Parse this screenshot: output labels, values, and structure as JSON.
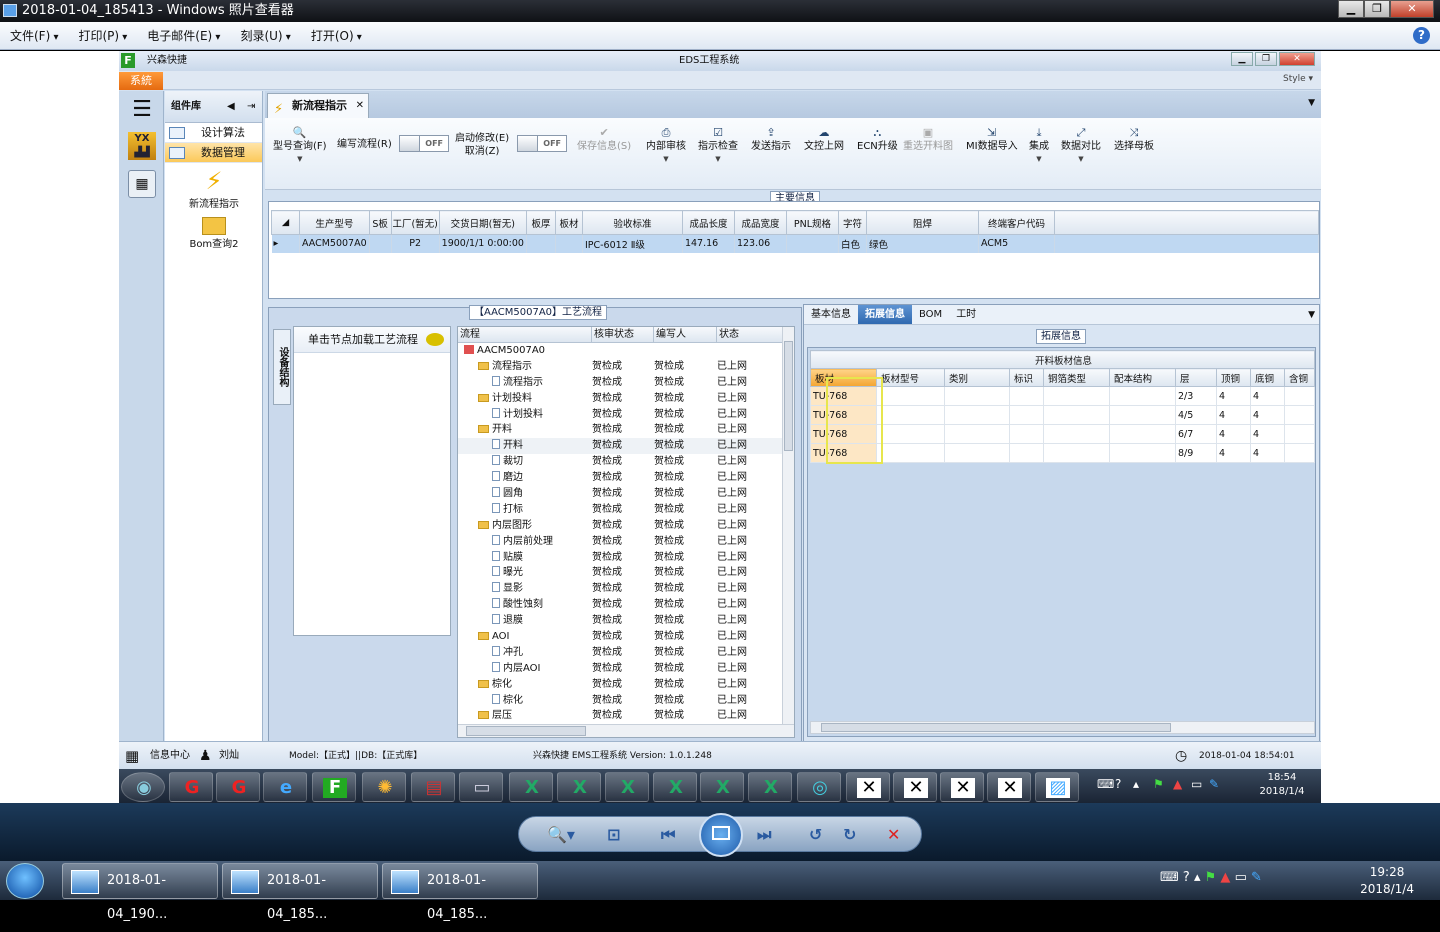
{
  "viewer": {
    "title": "2018-01-04_185413 - Windows 照片查看器",
    "menu": [
      "文件(F)",
      "打印(P)",
      "电子邮件(E)",
      "刻录(U)",
      "打开(O)"
    ],
    "help": "?"
  },
  "eds": {
    "app_short": "兴森快捷",
    "window_title": "EDS工程系统",
    "system_tab": "系統",
    "style_label": "Style ▾",
    "component_lib": "组件库",
    "lib_items": [
      "设计算法",
      "数据管理"
    ],
    "tools": [
      "新流程指示",
      "Bom查询2"
    ],
    "doc_tab": "新流程指示",
    "toolbar": {
      "model_query": "型号查询(F)",
      "write_flow": "编写流程(R)",
      "start_modify": "启动修改(E)",
      "cancel": "取消(Z)",
      "off": "OFF",
      "save_info": "保存信息(S)",
      "internal_review": "内部审核",
      "indicator_check": "指示检查",
      "publish_indicator": "发送指示",
      "upload_file": "文控上网",
      "ecn_upgrade": "ECN升级",
      "reselect_diagram": "重选开料图",
      "mi_import": "MI数据导入",
      "integrate": "集成",
      "data_compare": "数据对比",
      "select_mother": "选择母板"
    },
    "main_info": {
      "title": "主要信息",
      "headers": [
        "生产型号",
        "S板",
        "工厂(暂无)",
        "交货日期(暂无)",
        "板厚",
        "板材",
        "验收标准",
        "成品长度",
        "成品宽度",
        "PNL规格",
        "字符",
        "阻焊",
        "终端客户代码"
      ],
      "row": [
        "AACM5007A0",
        "",
        "P2",
        "1900/1/1 0:00:00",
        "",
        "",
        "IPC-6012 Ⅱ级",
        "147.16",
        "123.06",
        "",
        "白色",
        "绿色",
        "ACM5"
      ]
    },
    "process": {
      "title": "【AACM5007A0】工艺流程",
      "side_tab": "设备结构",
      "load_hint": "单击节点加载工艺流程",
      "headers": [
        "流程",
        "核审状态",
        "编写人",
        "状态"
      ],
      "rows": [
        {
          "name": "AACM5007A0",
          "level": 0,
          "type": "root",
          "status": "",
          "writer": "",
          "state": ""
        },
        {
          "name": "流程指示",
          "level": 1,
          "type": "folder",
          "status": "贺检成",
          "writer": "贺检成",
          "state": "已上网"
        },
        {
          "name": "流程指示",
          "level": 2,
          "type": "file",
          "status": "贺检成",
          "writer": "贺检成",
          "state": "已上网"
        },
        {
          "name": "计划投料",
          "level": 1,
          "type": "folder",
          "status": "贺检成",
          "writer": "贺检成",
          "state": "已上网"
        },
        {
          "name": "计划投料",
          "level": 2,
          "type": "file",
          "status": "贺检成",
          "writer": "贺检成",
          "state": "已上网"
        },
        {
          "name": "开料",
          "level": 1,
          "type": "folder",
          "status": "贺检成",
          "writer": "贺检成",
          "state": "已上网"
        },
        {
          "name": "开料",
          "level": 2,
          "type": "file",
          "status": "贺检成",
          "writer": "贺检成",
          "state": "已上网"
        },
        {
          "name": "裁切",
          "level": 2,
          "type": "file",
          "status": "贺检成",
          "writer": "贺检成",
          "state": "已上网"
        },
        {
          "name": "磨边",
          "level": 2,
          "type": "file",
          "status": "贺检成",
          "writer": "贺检成",
          "state": "已上网"
        },
        {
          "name": "圆角",
          "level": 2,
          "type": "file",
          "status": "贺检成",
          "writer": "贺检成",
          "state": "已上网"
        },
        {
          "name": "打标",
          "level": 2,
          "type": "file",
          "status": "贺检成",
          "writer": "贺检成",
          "state": "已上网"
        },
        {
          "name": "内层图形",
          "level": 1,
          "type": "folder",
          "status": "贺检成",
          "writer": "贺检成",
          "state": "已上网"
        },
        {
          "name": "内层前处理",
          "level": 2,
          "type": "file",
          "status": "贺检成",
          "writer": "贺检成",
          "state": "已上网"
        },
        {
          "name": "贴膜",
          "level": 2,
          "type": "file",
          "status": "贺检成",
          "writer": "贺检成",
          "state": "已上网"
        },
        {
          "name": "曝光",
          "level": 2,
          "type": "file",
          "status": "贺检成",
          "writer": "贺检成",
          "state": "已上网"
        },
        {
          "name": "显影",
          "level": 2,
          "type": "file",
          "status": "贺检成",
          "writer": "贺检成",
          "state": "已上网"
        },
        {
          "name": "酸性蚀刻",
          "level": 2,
          "type": "file",
          "status": "贺检成",
          "writer": "贺检成",
          "state": "已上网"
        },
        {
          "name": "退膜",
          "level": 2,
          "type": "file",
          "status": "贺检成",
          "writer": "贺检成",
          "state": "已上网"
        },
        {
          "name": "AOI",
          "level": 1,
          "type": "folder",
          "status": "贺检成",
          "writer": "贺检成",
          "state": "已上网"
        },
        {
          "name": "冲孔",
          "level": 2,
          "type": "file",
          "status": "贺检成",
          "writer": "贺检成",
          "state": "已上网"
        },
        {
          "name": "内层AOI",
          "level": 2,
          "type": "file",
          "status": "贺检成",
          "writer": "贺检成",
          "state": "已上网"
        },
        {
          "name": "棕化",
          "level": 1,
          "type": "folder",
          "status": "贺检成",
          "writer": "贺检成",
          "state": "已上网"
        },
        {
          "name": "棕化",
          "level": 2,
          "type": "file",
          "status": "贺检成",
          "writer": "贺检成",
          "state": "已上网"
        },
        {
          "name": "层压",
          "level": 1,
          "type": "folder",
          "status": "贺检成",
          "writer": "贺检成",
          "state": "已上网"
        }
      ]
    },
    "right_tabs": [
      "基本信息",
      "拓展信息",
      "BOM",
      "工时"
    ],
    "ext_info": {
      "title": "拓展信息",
      "caption": "开料板材信息",
      "headers": [
        "板材",
        "板材型号",
        "类别",
        "标识",
        "铜箔类型",
        "配本结构",
        "层",
        "顶铜",
        "底铜",
        "含铜"
      ],
      "rows": [
        [
          "TU-768",
          "",
          "",
          "",
          "",
          "",
          "2/3",
          "4",
          "4",
          ""
        ],
        [
          "TU-768",
          "",
          "",
          "",
          "",
          "",
          "4/5",
          "4",
          "4",
          ""
        ],
        [
          "TU-768",
          "",
          "",
          "",
          "",
          "",
          "6/7",
          "4",
          "4",
          ""
        ],
        [
          "TU-768",
          "",
          "",
          "",
          "",
          "",
          "8/9",
          "4",
          "4",
          ""
        ]
      ]
    },
    "status": {
      "info_center": "信息中心",
      "user": "刘灿",
      "model": "Model:【正式】||DB:【正式库】",
      "version": "兴森快捷  EMS工程系统  Version: 1.0.1.248",
      "datetime": "2018-01-04  18:54:01"
    },
    "inner_clock": {
      "time": "18:54",
      "date": "2018/1/4"
    }
  },
  "os": {
    "tasks": [
      "2018-01-04_190...",
      "2018-01-04_185...",
      "2018-01-04_185..."
    ],
    "clock": {
      "time": "19:28",
      "date": "2018/1/4"
    }
  }
}
